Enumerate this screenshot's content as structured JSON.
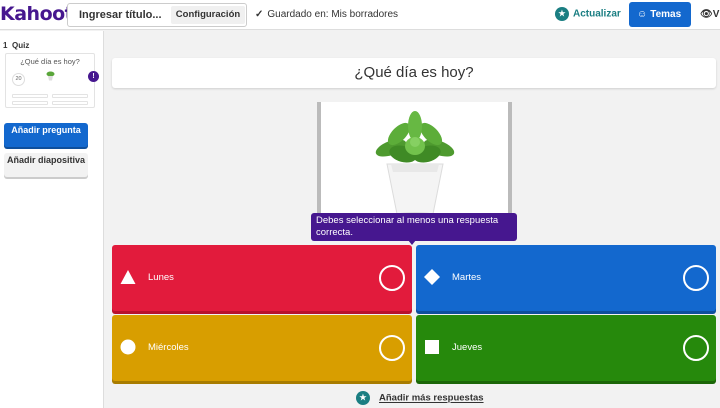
{
  "header": {
    "logo": "Kahoot!",
    "title_placeholder": "Ingresar título...",
    "config_label": "Configuración",
    "saved_text": "Guardado en: Mis borradores",
    "update_label": "Actualizar",
    "themes_label": "Temas",
    "view_label": "V"
  },
  "sidebar": {
    "question_number": "1",
    "question_type": "Quiz",
    "thumb_title": "¿Qué día es hoy?",
    "thumb_timer": "20",
    "warning": "!",
    "add_question": "Añadir pregunta",
    "add_slide": "Añadir diapositiva"
  },
  "question": {
    "text": "¿Qué día es hoy?"
  },
  "tooltip": {
    "text": "Debes seleccionar al menos una respuesta correcta."
  },
  "answers": [
    {
      "label": "Lunes",
      "shape": "triangle",
      "color": "#e21b3c"
    },
    {
      "label": "Martes",
      "shape": "diamond",
      "color": "#1368ce"
    },
    {
      "label": "Miércoles",
      "shape": "circle",
      "color": "#d89e00"
    },
    {
      "label": "Jueves",
      "shape": "square",
      "color": "#26890c"
    }
  ],
  "footer": {
    "add_more": "Añadir más respuestas"
  },
  "colors": {
    "brand": "#46178f",
    "primary": "#1368ce",
    "teal": "#1a7e82"
  }
}
